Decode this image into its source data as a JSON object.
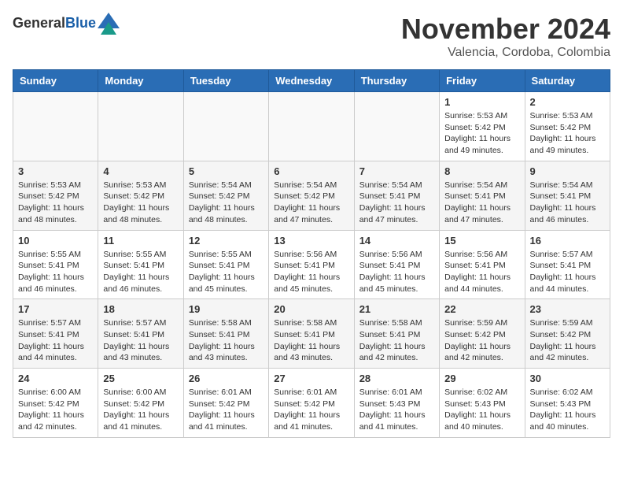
{
  "header": {
    "logo_general": "General",
    "logo_blue": "Blue",
    "title": "November 2024",
    "subtitle": "Valencia, Cordoba, Colombia"
  },
  "days_of_week": [
    "Sunday",
    "Monday",
    "Tuesday",
    "Wednesday",
    "Thursday",
    "Friday",
    "Saturday"
  ],
  "weeks": [
    [
      {
        "day": "",
        "info": ""
      },
      {
        "day": "",
        "info": ""
      },
      {
        "day": "",
        "info": ""
      },
      {
        "day": "",
        "info": ""
      },
      {
        "day": "",
        "info": ""
      },
      {
        "day": "1",
        "info": "Sunrise: 5:53 AM\nSunset: 5:42 PM\nDaylight: 11 hours\nand 49 minutes."
      },
      {
        "day": "2",
        "info": "Sunrise: 5:53 AM\nSunset: 5:42 PM\nDaylight: 11 hours\nand 49 minutes."
      }
    ],
    [
      {
        "day": "3",
        "info": "Sunrise: 5:53 AM\nSunset: 5:42 PM\nDaylight: 11 hours\nand 48 minutes."
      },
      {
        "day": "4",
        "info": "Sunrise: 5:53 AM\nSunset: 5:42 PM\nDaylight: 11 hours\nand 48 minutes."
      },
      {
        "day": "5",
        "info": "Sunrise: 5:54 AM\nSunset: 5:42 PM\nDaylight: 11 hours\nand 48 minutes."
      },
      {
        "day": "6",
        "info": "Sunrise: 5:54 AM\nSunset: 5:42 PM\nDaylight: 11 hours\nand 47 minutes."
      },
      {
        "day": "7",
        "info": "Sunrise: 5:54 AM\nSunset: 5:41 PM\nDaylight: 11 hours\nand 47 minutes."
      },
      {
        "day": "8",
        "info": "Sunrise: 5:54 AM\nSunset: 5:41 PM\nDaylight: 11 hours\nand 47 minutes."
      },
      {
        "day": "9",
        "info": "Sunrise: 5:54 AM\nSunset: 5:41 PM\nDaylight: 11 hours\nand 46 minutes."
      }
    ],
    [
      {
        "day": "10",
        "info": "Sunrise: 5:55 AM\nSunset: 5:41 PM\nDaylight: 11 hours\nand 46 minutes."
      },
      {
        "day": "11",
        "info": "Sunrise: 5:55 AM\nSunset: 5:41 PM\nDaylight: 11 hours\nand 46 minutes."
      },
      {
        "day": "12",
        "info": "Sunrise: 5:55 AM\nSunset: 5:41 PM\nDaylight: 11 hours\nand 45 minutes."
      },
      {
        "day": "13",
        "info": "Sunrise: 5:56 AM\nSunset: 5:41 PM\nDaylight: 11 hours\nand 45 minutes."
      },
      {
        "day": "14",
        "info": "Sunrise: 5:56 AM\nSunset: 5:41 PM\nDaylight: 11 hours\nand 45 minutes."
      },
      {
        "day": "15",
        "info": "Sunrise: 5:56 AM\nSunset: 5:41 PM\nDaylight: 11 hours\nand 44 minutes."
      },
      {
        "day": "16",
        "info": "Sunrise: 5:57 AM\nSunset: 5:41 PM\nDaylight: 11 hours\nand 44 minutes."
      }
    ],
    [
      {
        "day": "17",
        "info": "Sunrise: 5:57 AM\nSunset: 5:41 PM\nDaylight: 11 hours\nand 44 minutes."
      },
      {
        "day": "18",
        "info": "Sunrise: 5:57 AM\nSunset: 5:41 PM\nDaylight: 11 hours\nand 43 minutes."
      },
      {
        "day": "19",
        "info": "Sunrise: 5:58 AM\nSunset: 5:41 PM\nDaylight: 11 hours\nand 43 minutes."
      },
      {
        "day": "20",
        "info": "Sunrise: 5:58 AM\nSunset: 5:41 PM\nDaylight: 11 hours\nand 43 minutes."
      },
      {
        "day": "21",
        "info": "Sunrise: 5:58 AM\nSunset: 5:41 PM\nDaylight: 11 hours\nand 42 minutes."
      },
      {
        "day": "22",
        "info": "Sunrise: 5:59 AM\nSunset: 5:42 PM\nDaylight: 11 hours\nand 42 minutes."
      },
      {
        "day": "23",
        "info": "Sunrise: 5:59 AM\nSunset: 5:42 PM\nDaylight: 11 hours\nand 42 minutes."
      }
    ],
    [
      {
        "day": "24",
        "info": "Sunrise: 6:00 AM\nSunset: 5:42 PM\nDaylight: 11 hours\nand 42 minutes."
      },
      {
        "day": "25",
        "info": "Sunrise: 6:00 AM\nSunset: 5:42 PM\nDaylight: 11 hours\nand 41 minutes."
      },
      {
        "day": "26",
        "info": "Sunrise: 6:01 AM\nSunset: 5:42 PM\nDaylight: 11 hours\nand 41 minutes."
      },
      {
        "day": "27",
        "info": "Sunrise: 6:01 AM\nSunset: 5:42 PM\nDaylight: 11 hours\nand 41 minutes."
      },
      {
        "day": "28",
        "info": "Sunrise: 6:01 AM\nSunset: 5:43 PM\nDaylight: 11 hours\nand 41 minutes."
      },
      {
        "day": "29",
        "info": "Sunrise: 6:02 AM\nSunset: 5:43 PM\nDaylight: 11 hours\nand 40 minutes."
      },
      {
        "day": "30",
        "info": "Sunrise: 6:02 AM\nSunset: 5:43 PM\nDaylight: 11 hours\nand 40 minutes."
      }
    ]
  ]
}
